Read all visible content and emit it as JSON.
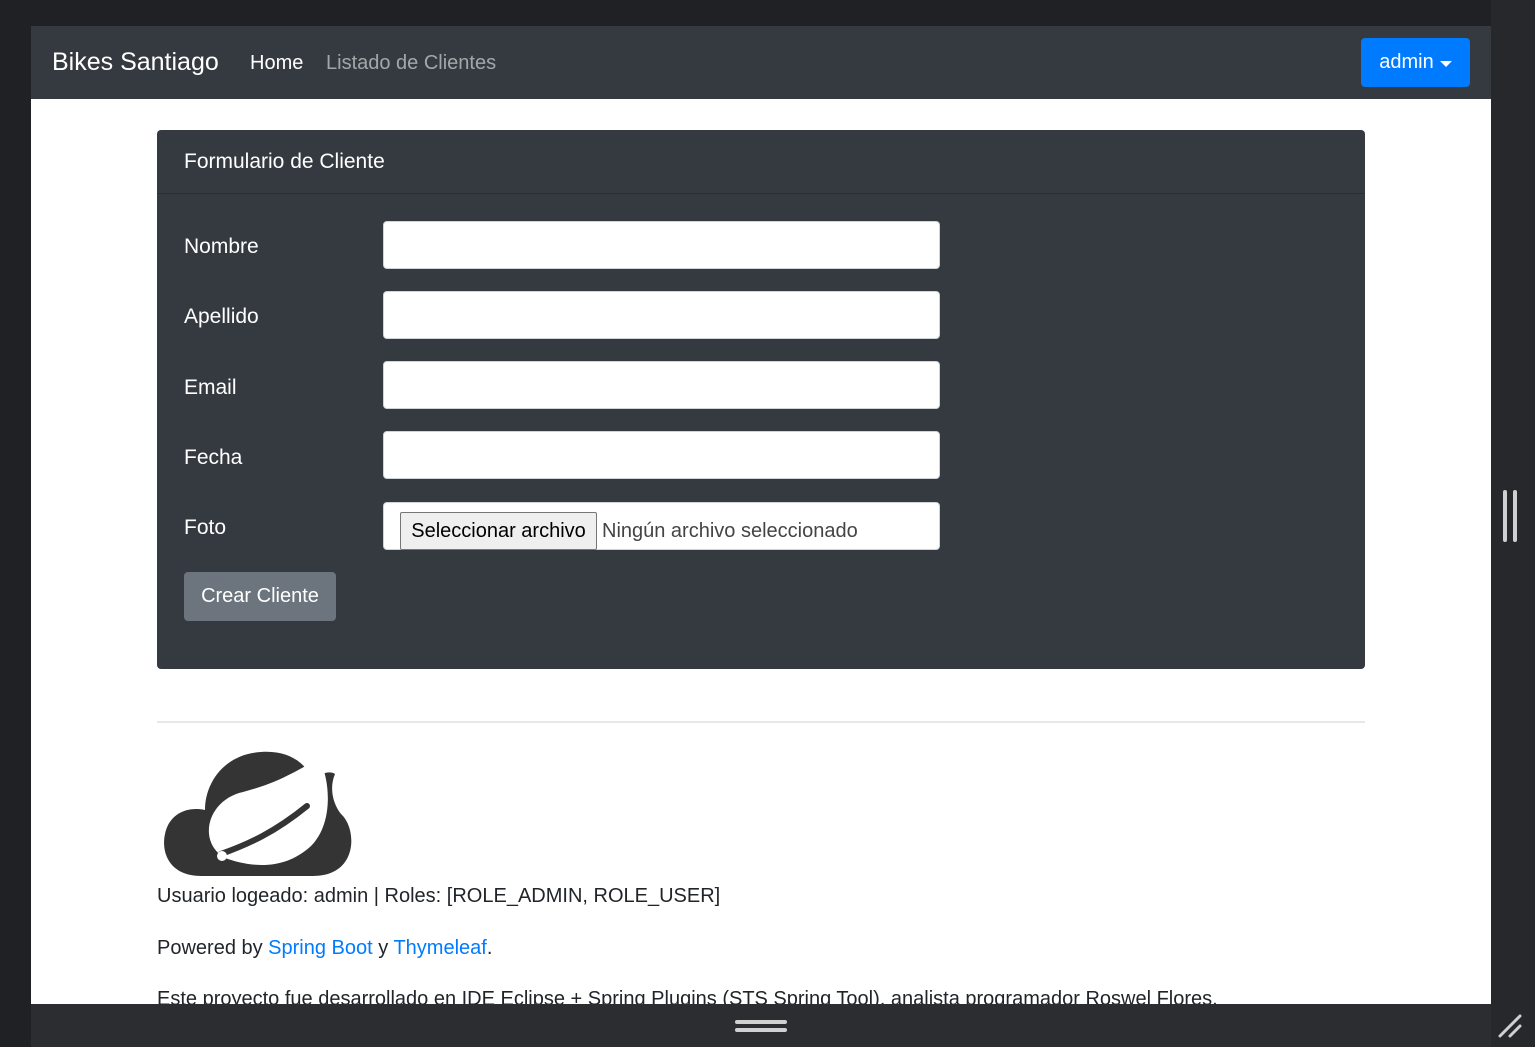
{
  "navbar": {
    "brand": "Bikes Santiago",
    "home_label": "Home",
    "list_label": "Listado de Clientes",
    "user_menu_label": "admin"
  },
  "form": {
    "title": "Formulario de Cliente",
    "fields": [
      {
        "label": "Nombre",
        "value": ""
      },
      {
        "label": "Apellido",
        "value": ""
      },
      {
        "label": "Email",
        "value": ""
      },
      {
        "label": "Fecha",
        "value": ""
      }
    ],
    "photo": {
      "label": "Foto",
      "button_label": "Seleccionar archivo",
      "status": "Ningún archivo seleccionado"
    },
    "submit_label": "Crear Cliente"
  },
  "footer": {
    "session_info": "Usuario logeado: admin | Roles: [ROLE_ADMIN, ROLE_USER]",
    "powered_prefix": "Powered by ",
    "spring_boot_link": "Spring Boot",
    "powered_conjunction": " y ",
    "thymeleaf_link": "Thymeleaf",
    "powered_suffix": ".",
    "project_note": "Este proyecto fue desarrollado en IDE Eclipse + Spring Plugins (STS Spring Tool), analista programador Roswel Flores."
  },
  "icons": {
    "logo": "spring-cloud-leaf-logo",
    "user_caret": "caret-down-icon",
    "resize": "resize-grip-icon"
  },
  "colors": {
    "navbar_bg": "#343a40",
    "primary": "#007bff",
    "secondary": "#6c757d",
    "link": "#007bff"
  }
}
